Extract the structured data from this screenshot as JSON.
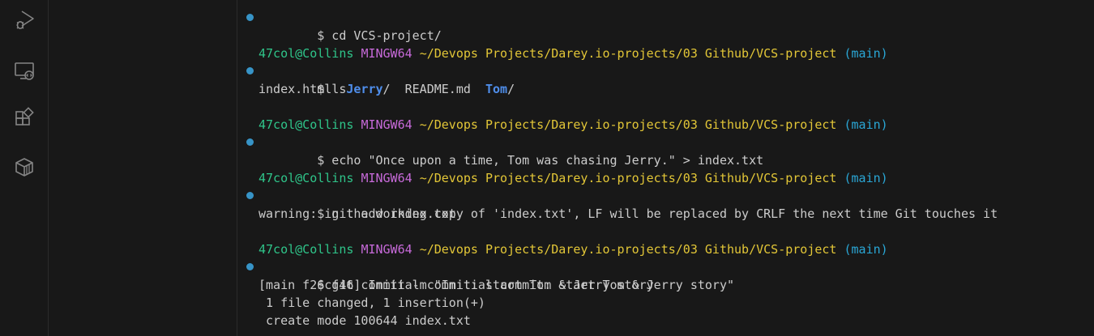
{
  "activity_bar": {
    "icons": [
      "run-debug-icon",
      "remote-explorer-icon",
      "extensions-icon",
      "package-icon"
    ]
  },
  "colors": {
    "background": "#181818",
    "text": "#cccccc",
    "user_host": "#2fc58a",
    "shell": "#c76ad9",
    "path": "#e2c637",
    "branch": "#2aa7d6",
    "dir": "#4f8eeb",
    "dot": "#3794c7"
  },
  "terminal": {
    "cmd1": "$ cd VCS-project/",
    "prompt": {
      "user": "47col@Collins",
      "shell": "MINGW64",
      "path": "~/Devops Projects/Darey.io-projects/03 Github/VCS-project",
      "branch": "(main)"
    },
    "cmd2": "$ ls",
    "ls_output": {
      "file1": "index.html",
      "dir1": "Jerry",
      "file2": "README.md",
      "dir2": "Tom",
      "slash": "/"
    },
    "cmd3": "$ echo \"Once upon a time, Tom was chasing Jerry.\" > index.txt",
    "cmd4": "$ git add index.txt",
    "warning": "warning: in the working copy of 'index.txt', LF will be replaced by CRLF the next time Git touches it",
    "cmd5": "$ git commit -m \"Initial commit: start Tom & Jerry story\"",
    "commit_out1": "[main f26cf46] Initial commit: start Tom & Jerry story",
    "commit_out2": " 1 file changed, 1 insertion(+)",
    "commit_out3": " create mode 100644 index.txt"
  }
}
